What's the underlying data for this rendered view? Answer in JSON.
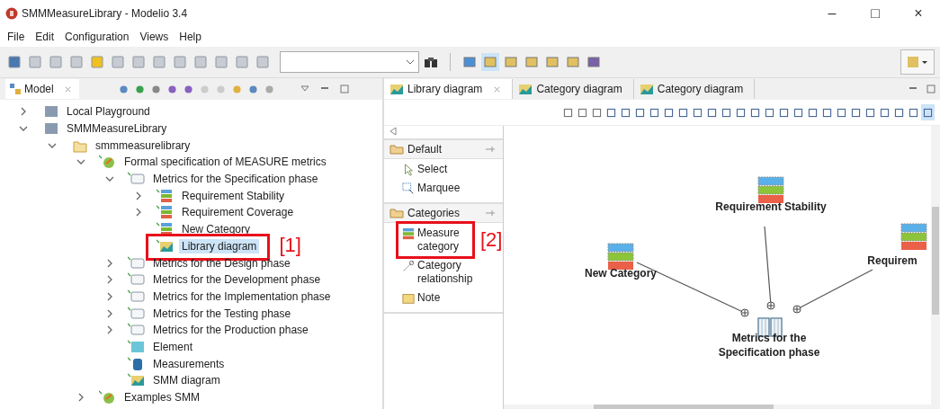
{
  "window": {
    "title": "SMMMeasureLibrary - Modelio 3.4",
    "controls": [
      "–",
      "□",
      "×"
    ]
  },
  "menu": [
    "File",
    "Edit",
    "Configuration",
    "Views",
    "Help"
  ],
  "model_view": {
    "title": "Model",
    "tree": [
      {
        "label": "Local Playground",
        "kind": "project",
        "expanded": false,
        "selected": false
      },
      {
        "label": "SMMMeasureLibrary",
        "kind": "project",
        "expanded": true,
        "selected": false,
        "children": [
          {
            "label": "smmmeasurelibrary",
            "kind": "package",
            "expanded": true,
            "selected": false,
            "children": [
              {
                "label": "Formal specification of MEASURE metrics",
                "kind": "model",
                "expanded": true,
                "selected": false,
                "children": [
                  {
                    "label": "Metrics for the Specification phase",
                    "kind": "library",
                    "expanded": true,
                    "selected": false,
                    "children": [
                      {
                        "label": "Requirement Stability",
                        "kind": "category",
                        "expanded": false,
                        "selected": false
                      },
                      {
                        "label": "Requirement Coverage",
                        "kind": "category",
                        "expanded": false,
                        "selected": false
                      },
                      {
                        "label": "New Category",
                        "kind": "category",
                        "selected": false
                      },
                      {
                        "label": "Library diagram",
                        "kind": "diagram",
                        "selected": true,
                        "callout": "[1]"
                      }
                    ]
                  },
                  {
                    "label": "Metrics for the Design phase",
                    "kind": "library",
                    "expanded": false,
                    "selected": false
                  },
                  {
                    "label": "Metrics for the Development phase",
                    "kind": "library",
                    "expanded": false,
                    "selected": false
                  },
                  {
                    "label": "Metrics for the Implementation phase",
                    "kind": "library",
                    "expanded": false,
                    "selected": false
                  },
                  {
                    "label": "Metrics for the Testing phase",
                    "kind": "library",
                    "expanded": false,
                    "selected": false
                  },
                  {
                    "label": "Metrics for the Production phase",
                    "kind": "library",
                    "expanded": false,
                    "selected": false
                  },
                  {
                    "label": "Element",
                    "kind": "element",
                    "selected": false
                  },
                  {
                    "label": "Measurements",
                    "kind": "measurements",
                    "selected": false
                  },
                  {
                    "label": "SMM diagram",
                    "kind": "diagram",
                    "selected": false
                  }
                ]
              },
              {
                "label": "Examples SMM",
                "kind": "model",
                "expanded": false,
                "selected": false
              }
            ]
          }
        ]
      }
    ]
  },
  "editor": {
    "tabs": [
      {
        "label": "Library diagram",
        "selected": true
      },
      {
        "label": "Category diagram",
        "selected": false
      },
      {
        "label": "Category diagram",
        "selected": false
      }
    ],
    "palette": {
      "sections": [
        {
          "label": "Default",
          "items": [
            {
              "label": "Select",
              "kind": "select"
            },
            {
              "label": "Marquee",
              "kind": "marquee"
            }
          ]
        },
        {
          "label": "Categories",
          "items": [
            {
              "label": "Measure category",
              "kind": "category",
              "callout": "[2]"
            },
            {
              "label": "Category relationship",
              "kind": "relationship"
            },
            {
              "label": "Note",
              "kind": "note"
            }
          ]
        }
      ]
    },
    "diagram": {
      "nodes": [
        {
          "label": "Requirement Stability",
          "kind": "category"
        },
        {
          "label": "New Category",
          "kind": "category"
        },
        {
          "label": "Requirem",
          "kind": "category"
        },
        {
          "label": "Metrics for the Specification phase",
          "kind": "library"
        }
      ]
    }
  }
}
